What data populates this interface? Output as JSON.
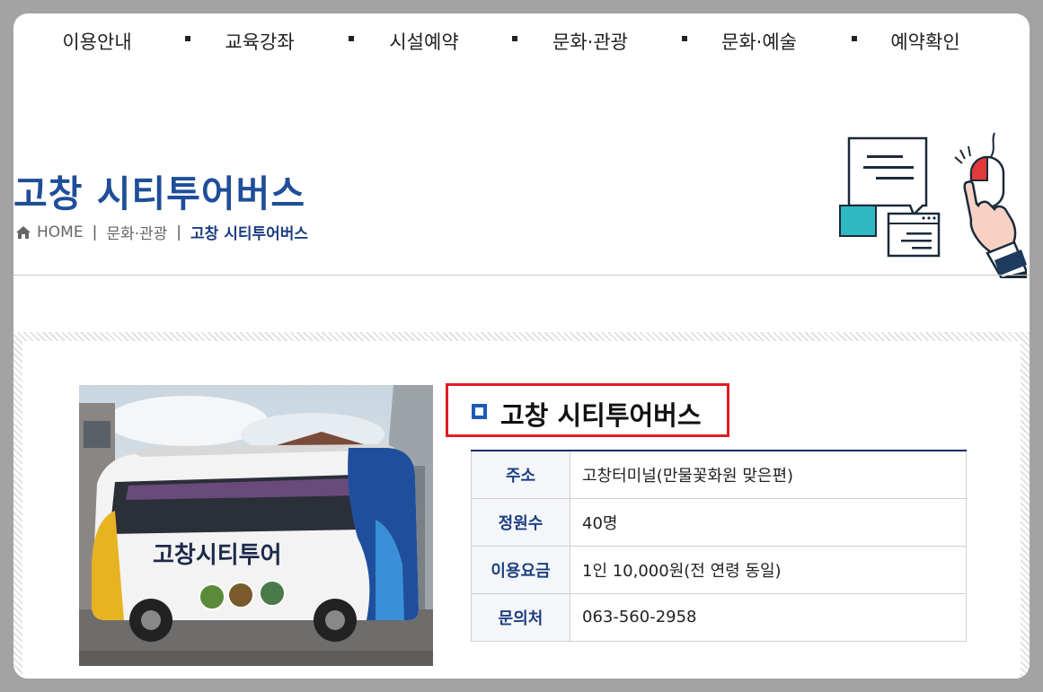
{
  "nav": {
    "items": [
      "이용안내",
      "교육강좌",
      "시설예약",
      "문화·관광",
      "문화·예술",
      "예약확인"
    ]
  },
  "header": {
    "title": "고창 시티투어버스",
    "breadcrumb": {
      "home": "HOME",
      "section": "문화·관광",
      "current": "고창 시티투어버스"
    }
  },
  "bus_image": {
    "bus_lettering": "고창시티투어"
  },
  "info": {
    "title": "고창 시티투어버스",
    "rows": [
      {
        "key": "주소",
        "value": "고창터미널(만물꽃화원 맞은편)"
      },
      {
        "key": "정원수",
        "value": "40명"
      },
      {
        "key": "이용요금",
        "value": "1인 10,000원(전 연령 동일)"
      },
      {
        "key": "문의처",
        "value": "063-560-2958"
      }
    ]
  },
  "colors": {
    "title_blue": "#1f4e99",
    "highlight_red": "#e01c24",
    "table_border_top": "#1c2b6e",
    "bullet_blue": "#1e5bb8"
  },
  "icons": [
    "home-icon",
    "square-bullet-icon",
    "chat-mouse-illustration"
  ]
}
